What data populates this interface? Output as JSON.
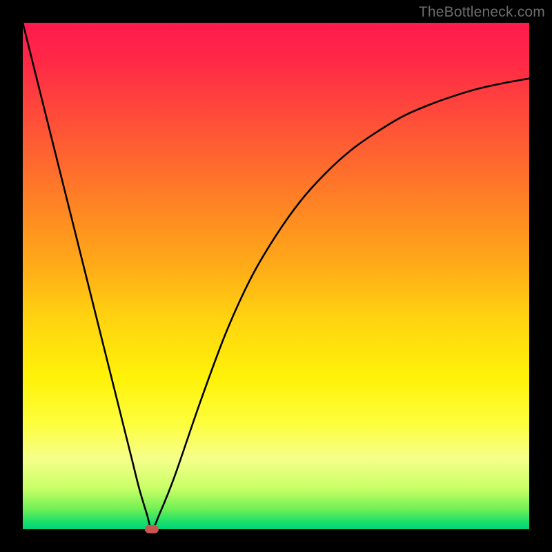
{
  "watermark": "TheBottleneck.com",
  "colors": {
    "frame": "#000000",
    "gradient_top": "#ff1a4d",
    "gradient_bottom": "#00d47a",
    "curve": "#000000",
    "marker": "#c7564e",
    "watermark_text": "#6c6c6c"
  },
  "layout": {
    "size": 800,
    "inset": 33
  },
  "chart_data": {
    "type": "line",
    "title": "",
    "xlabel": "",
    "ylabel": "",
    "xlim": [
      0,
      1
    ],
    "ylim": [
      0,
      1
    ],
    "x": [
      0.0,
      0.025,
      0.05,
      0.075,
      0.1,
      0.125,
      0.15,
      0.175,
      0.2,
      0.215,
      0.23,
      0.245,
      0.255,
      0.27,
      0.3,
      0.35,
      0.4,
      0.45,
      0.5,
      0.55,
      0.6,
      0.65,
      0.7,
      0.75,
      0.8,
      0.85,
      0.9,
      0.95,
      1.0
    ],
    "y": [
      1.0,
      0.9,
      0.8,
      0.7,
      0.6,
      0.5,
      0.4,
      0.3,
      0.2,
      0.14,
      0.08,
      0.03,
      0.0,
      0.03,
      0.105,
      0.25,
      0.385,
      0.495,
      0.58,
      0.65,
      0.705,
      0.75,
      0.785,
      0.815,
      0.837,
      0.855,
      0.87,
      0.881,
      0.89
    ],
    "marker": {
      "x": 0.255,
      "y": 0.0
    }
  }
}
